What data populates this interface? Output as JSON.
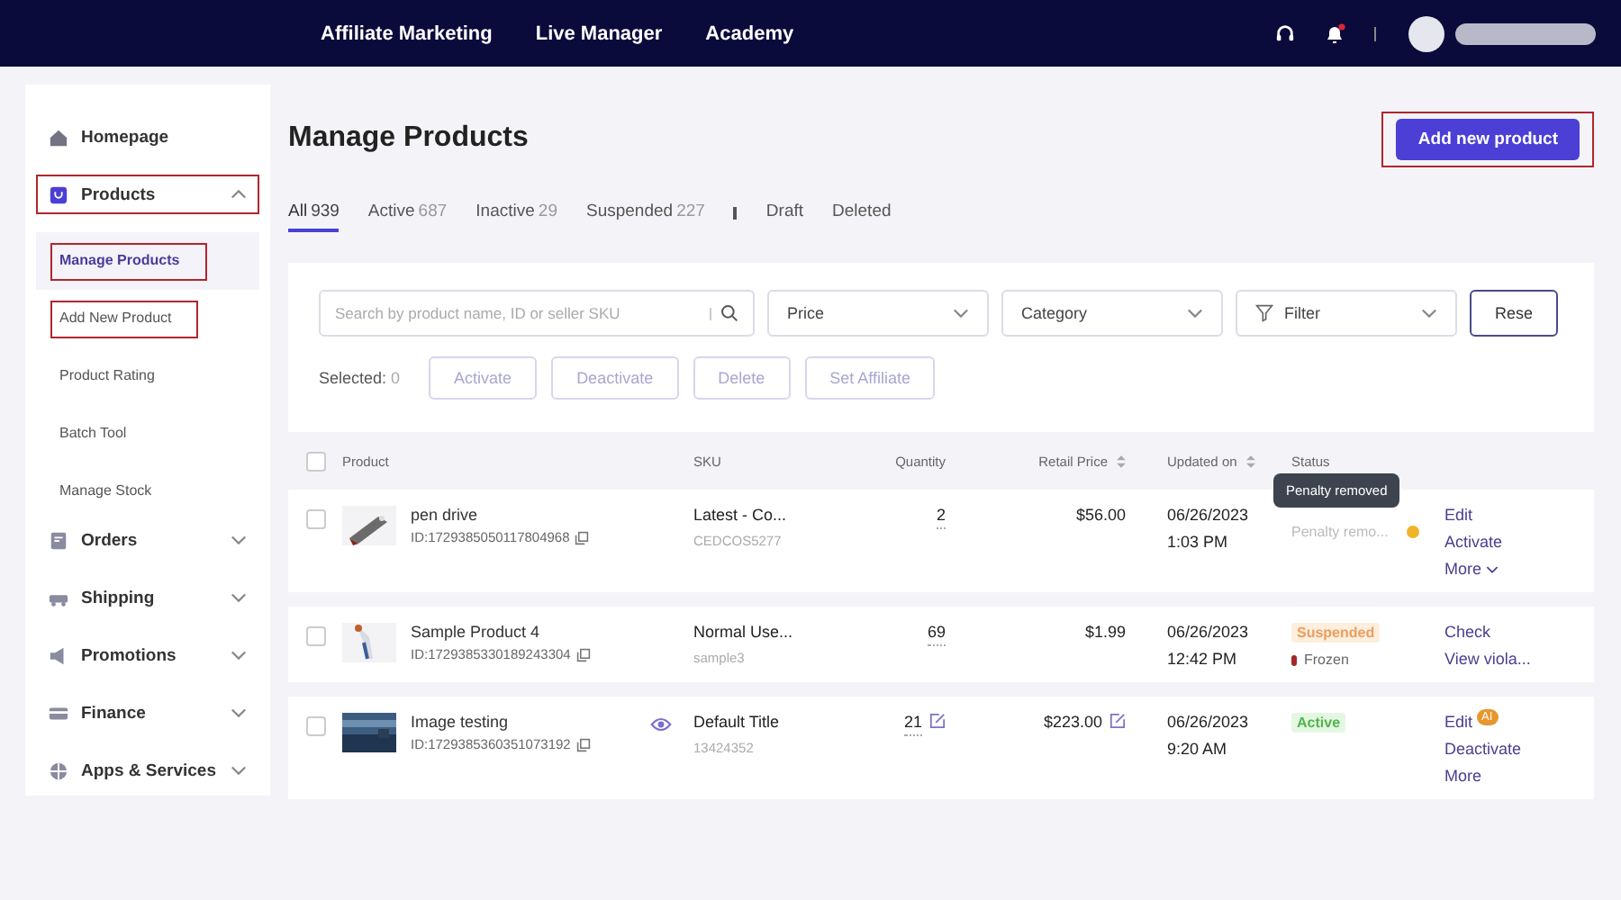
{
  "top_nav": {
    "links": [
      "Affiliate Marketing",
      "Live Manager",
      "Academy"
    ],
    "notifications_unread": true
  },
  "sidebar": {
    "items": [
      {
        "label": "Homepage",
        "highlighted": false
      },
      {
        "label": "Products",
        "expanded": true,
        "highlighted": true,
        "children": [
          {
            "label": "Manage Products",
            "selected": true,
            "highlighted": true
          },
          {
            "label": "Add New Product",
            "selected": false,
            "highlighted": true
          },
          {
            "label": "Product Rating",
            "selected": false,
            "highlighted": false
          },
          {
            "label": "Batch Tool",
            "selected": false,
            "highlighted": false
          },
          {
            "label": "Manage Stock",
            "selected": false,
            "highlighted": false
          }
        ]
      },
      {
        "label": "Orders",
        "expanded": false,
        "highlighted": false
      },
      {
        "label": "Shipping",
        "expanded": false,
        "highlighted": false
      },
      {
        "label": "Promotions",
        "expanded": false,
        "highlighted": false
      },
      {
        "label": "Finance",
        "expanded": false,
        "highlighted": false
      },
      {
        "label": "Apps & Services",
        "expanded": false,
        "highlighted": false
      }
    ]
  },
  "page": {
    "title": "Manage Products",
    "add_button": {
      "label": "Add new product",
      "highlighted": true
    }
  },
  "tabs": [
    {
      "label": "All",
      "count": "939",
      "selected": true
    },
    {
      "label": "Active",
      "count": "687",
      "selected": false
    },
    {
      "label": "Inactive",
      "count": "29",
      "selected": false
    },
    {
      "label": "Suspended",
      "count": "227",
      "selected": false
    },
    {
      "label": "Draft",
      "selected": false
    },
    {
      "label": "Deleted",
      "selected": false
    }
  ],
  "filters": {
    "search": {
      "placeholder": "Search by product name, ID or seller SKU"
    },
    "dropdowns": [
      {
        "label": "Price"
      },
      {
        "label": "Category"
      },
      {
        "label": "Filter",
        "kind": "filter"
      }
    ],
    "reset": "Rese",
    "selected_label": "Selected:",
    "selected_count": "0",
    "bulk_actions": [
      "Activate",
      "Deactivate",
      "Delete",
      "Set Affiliate"
    ]
  },
  "table": {
    "select_all": {
      "checked": false
    },
    "columns": [
      {
        "label": "Product",
        "sortable": false
      },
      {
        "label": "SKU",
        "sortable": false
      },
      {
        "label": "Quantity",
        "sortable": false
      },
      {
        "label": "Retail Price",
        "sortable": true
      },
      {
        "label": "Updated on",
        "sortable": true
      },
      {
        "label": "Status",
        "sortable": false
      }
    ],
    "rows": [
      {
        "checked": false,
        "name": "pen drive",
        "id": "ID:1729385050117804968",
        "preview": false,
        "sku": "Latest - Co...",
        "sku_code": "CEDCOS5277",
        "quantity": "2",
        "quantity_editable": false,
        "price": "$56.00",
        "price_editable": false,
        "date": "06/26/2023",
        "time": "1:03 PM",
        "sub_status": {
          "label": "Penalty remo...",
          "color": "#f0b429"
        },
        "tooltip": "Penalty removed",
        "actions": [
          {
            "label": "Edit"
          },
          {
            "label": "Activate"
          },
          {
            "label": "More",
            "dropdown": true
          }
        ]
      },
      {
        "checked": false,
        "name": "Sample Product 4",
        "id": "ID:1729385330189243304",
        "preview": false,
        "sku": "Normal Use...",
        "sku_code": "sample3",
        "quantity": "69",
        "quantity_editable": false,
        "price": "$1.99",
        "price_editable": false,
        "date": "06/26/2023",
        "time": "12:42 PM",
        "status": {
          "label": "Suspended",
          "kind": "suspended"
        },
        "sub_status": {
          "label": "Frozen",
          "color": "#a3262a"
        },
        "actions": [
          {
            "label": "Check"
          },
          {
            "label": "View viola..."
          }
        ]
      },
      {
        "checked": false,
        "name": "Image testing",
        "id": "ID:1729385360351073192",
        "preview": true,
        "sku": "Default Title",
        "sku_code": "13424352",
        "quantity": "21",
        "quantity_editable": true,
        "price": "$223.00",
        "price_editable": true,
        "date": "06/26/2023",
        "time": "9:20 AM",
        "status": {
          "label": "Active",
          "kind": "active"
        },
        "actions": [
          {
            "label": "Edit",
            "badge": "AI"
          },
          {
            "label": "Deactivate"
          },
          {
            "label": "More"
          }
        ]
      }
    ]
  }
}
